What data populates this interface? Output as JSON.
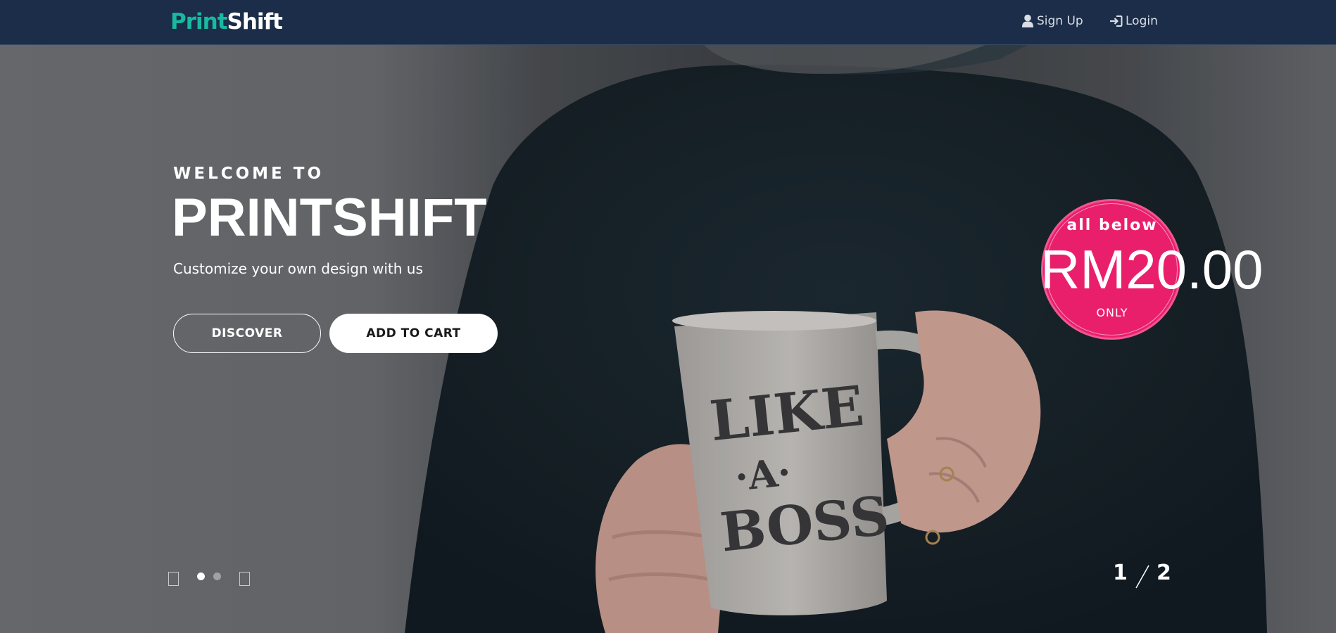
{
  "brand": {
    "part1": "Print",
    "part2": "Shift",
    "accent": "#19b9a0"
  },
  "nav": {
    "signup": {
      "label": "Sign Up",
      "icon": "user-icon"
    },
    "login": {
      "label": "Login",
      "icon": "login-icon"
    },
    "background": "#1b2d48"
  },
  "hero": {
    "kicker": "WELCOME TO",
    "title": "PRINTSHIFT",
    "subtitle": "Customize your own design with us",
    "buttons": {
      "discover": "DISCOVER",
      "add_to_cart": "ADD TO CART"
    },
    "mug_text": [
      "LIKE",
      "A",
      "BOSS"
    ]
  },
  "promo": {
    "top": "all below",
    "price": "RM20.00",
    "bottom": "ONLY",
    "color": "#ea1f6c"
  },
  "carousel": {
    "current": "1",
    "total": "2",
    "active_index": 0,
    "dots": 2
  }
}
